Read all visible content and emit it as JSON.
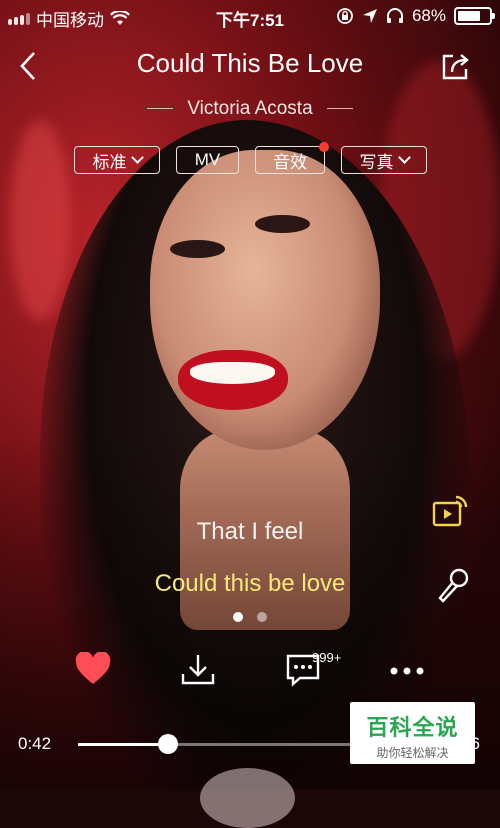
{
  "status_bar": {
    "carrier": "中国移动",
    "time": "下午7:51",
    "battery": "68%"
  },
  "header": {
    "title": "Could This Be Love",
    "artist": "Victoria Acosta"
  },
  "tags": [
    "标准",
    "MV",
    "音效",
    "写真"
  ],
  "lyrics": {
    "previous": "That I feel",
    "current": "Could this be love"
  },
  "pager": {
    "count": 2,
    "active": 0
  },
  "actions": {
    "comment_count": "999+"
  },
  "playback": {
    "elapsed": "0:42",
    "remaining": "6",
    "progress_fraction": 0.23
  },
  "watermark": {
    "title": "百科全说",
    "subtitle": "助你轻松解决"
  },
  "icons": [
    "signal-icon",
    "wifi-icon",
    "lock-rotation-icon",
    "location-icon",
    "headphones-icon",
    "battery-icon",
    "back-icon",
    "share-icon",
    "cast-icon",
    "microphone-icon",
    "heart-icon",
    "download-icon",
    "comment-icon",
    "more-icon"
  ],
  "colors": {
    "lyric_highlight": "#f6e87a",
    "heart": "#ff4d57",
    "accent_icon": "#f2d34b"
  }
}
